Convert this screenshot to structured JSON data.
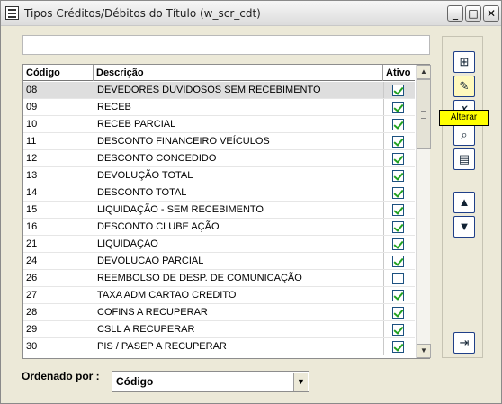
{
  "window": {
    "title": "Tipos Créditos/Débitos do Título (w_scr_cdt)",
    "buttons": {
      "minimize": "_",
      "maximize": "□",
      "close": "✕"
    }
  },
  "search": {
    "value": ""
  },
  "table": {
    "headers": {
      "code": "Código",
      "description": "Descrição",
      "active": "Ativo"
    },
    "rows": [
      {
        "code": "08",
        "description": "DEVEDORES DUVIDOSOS SEM RECEBIMENTO",
        "active": true,
        "selected": true
      },
      {
        "code": "09",
        "description": "RECEB",
        "active": true
      },
      {
        "code": "10",
        "description": "RECEB PARCIAL",
        "active": true
      },
      {
        "code": "11",
        "description": "DESCONTO FINANCEIRO VEÍCULOS",
        "active": true
      },
      {
        "code": "12",
        "description": "DESCONTO CONCEDIDO",
        "active": true
      },
      {
        "code": "13",
        "description": "DEVOLUÇÃO TOTAL",
        "active": true
      },
      {
        "code": "14",
        "description": "DESCONTO TOTAL",
        "active": true
      },
      {
        "code": "15",
        "description": "LIQUIDAÇÃO - SEM RECEBIMENTO",
        "active": true
      },
      {
        "code": "16",
        "description": "DESCONTO CLUBE AÇÃO",
        "active": true
      },
      {
        "code": "21",
        "description": "LIQUIDAÇAO",
        "active": true
      },
      {
        "code": "24",
        "description": "DEVOLUCAO PARCIAL",
        "active": true
      },
      {
        "code": "26",
        "description": "REEMBOLSO DE DESP. DE COMUNICAÇÃO",
        "active": false
      },
      {
        "code": "27",
        "description": "TAXA ADM CARTAO CREDITO",
        "active": true
      },
      {
        "code": "28",
        "description": "COFINS A RECUPERAR",
        "active": true
      },
      {
        "code": "29",
        "description": "CSLL A RECUPERAR",
        "active": true
      },
      {
        "code": "30",
        "description": "PIS / PASEP A RECUPERAR",
        "active": true
      }
    ]
  },
  "toolbar": {
    "tooltip": "Alterar",
    "icons": [
      "insert-icon",
      "edit-icon",
      "delete-icon",
      "search-icon",
      "report-icon",
      "move-up-icon",
      "move-down-icon",
      "exit-icon"
    ]
  },
  "order": {
    "label": "Ordenado por :",
    "value": "Código"
  }
}
